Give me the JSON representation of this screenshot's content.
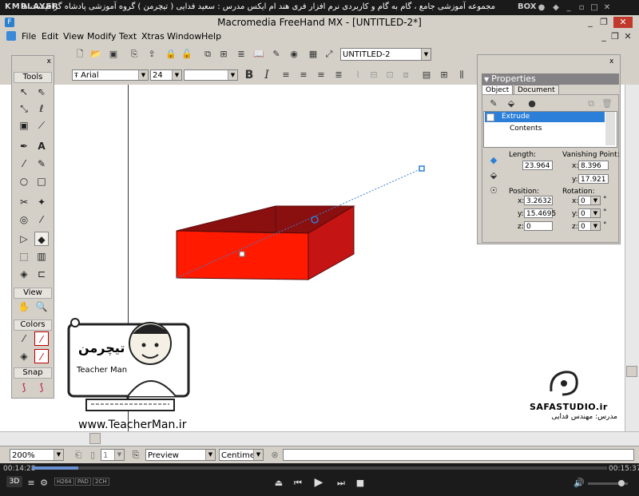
{
  "player": {
    "logo": "KMPLAYER",
    "title": "مجموعه آموزشی جامع ، گام به گام و کاربردی نرم افزار فری هند ام ایکس   مدرس : سعید فدایی ( تیچرمن ) گروه آموزشی پادشاه گرافیست ها",
    "box_label": "BOX",
    "time_current": "00:14:28",
    "time_total": "00:15:37",
    "progress": 0.08,
    "codec_tags": [
      "H264",
      "PAD",
      "2CH"
    ],
    "threed_label": "3D"
  },
  "app": {
    "title": "Macromedia FreeHand MX - [UNTITLED-2*]",
    "menu": [
      "File",
      "Edit",
      "View",
      "Modify",
      "Text",
      "Xtras",
      "Window",
      "Help"
    ]
  },
  "toolbar": {
    "document_select": "UNTITLED-2",
    "font_name": "Arial",
    "font_size": "24",
    "font_style": ""
  },
  "tools_panel": {
    "heading_tools": "Tools",
    "heading_view": "View",
    "heading_colors": "Colors",
    "heading_snap": "Snap",
    "close": "x"
  },
  "properties": {
    "title": "Properties",
    "close": "x",
    "tabs": [
      "Object",
      "Document"
    ],
    "tree": [
      "Extrude",
      "Contents"
    ],
    "length_label": "Length:",
    "length_value": "23.964",
    "vanishing_label": "Vanishing Point:",
    "vp_x": "8.396",
    "vp_y": "17.921",
    "position_label": "Position:",
    "pos_x": "3.2632",
    "pos_y": "15.4695",
    "pos_z": "0",
    "rotation_label": "Rotation:",
    "rot_x": "0",
    "rot_y": "0",
    "rot_z": "0",
    "x_lbl": "x:",
    "y_lbl": "y:",
    "z_lbl": "z:",
    "deg": "°"
  },
  "status": {
    "zoom": "200%",
    "page": "1",
    "view_mode": "Preview",
    "units": "Centimeters"
  },
  "branding": {
    "teacher_logo": "تیچرمن",
    "teacher_sub": "Teacher Man",
    "teacher_url": "www.TeacherMan.ir",
    "safa_name": "SAFASTUDIO.ir",
    "safa_teacher": "مدرس: مهندس فدایی"
  },
  "colors": {
    "extrude_front": "#ff1a00",
    "extrude_top": "#8a0f0f",
    "extrude_side": "#c41414",
    "selection": "#2b7fd9"
  }
}
